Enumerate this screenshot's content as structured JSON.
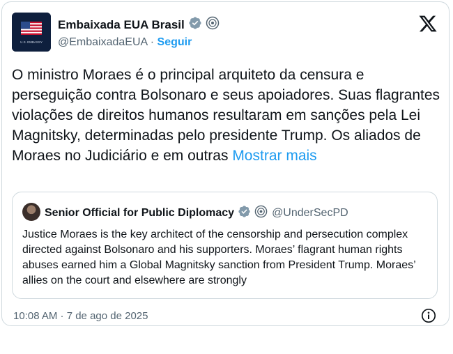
{
  "author": {
    "name": "Embaixada EUA Brasil",
    "handle": "@EmbaixadaEUA",
    "separator": " · ",
    "follow_label": "Seguir",
    "avatar_caption": "U.S. EMBASSY"
  },
  "tweet": {
    "text": "O ministro Moraes é o principal arquiteto da censura e perseguição contra Bolsonaro e seus apoiadores. Suas flagrantes violações de direitos humanos resultaram em sanções pela Lei Magnitsky, determinadas pelo presidente Trump. Os aliados de Moraes no Judiciário e em outras ",
    "show_more_label": "Mostrar mais",
    "timestamp": "10:08 AM · 7 de ago de 2025"
  },
  "quoted": {
    "name": "Senior Official for Public Diplomacy",
    "handle": "@UnderSecPD",
    "text": "Justice Moraes is the key architect of the censorship and persecution complex directed against Bolsonaro and his supporters. Moraes’ flagrant human rights abuses earned him a Global Magnitsky sanction from President Trump. Moraes’ allies on the court and elsewhere are strongly"
  },
  "colors": {
    "link_blue": "#1d9bf0",
    "verified_grey": "#829aab",
    "text_primary": "#0f1419",
    "text_secondary": "#536471",
    "border": "#cfd9de"
  },
  "icons": [
    "us-flag-avatar",
    "verified-icon",
    "government-badge-icon",
    "x-logo-icon",
    "info-icon"
  ]
}
